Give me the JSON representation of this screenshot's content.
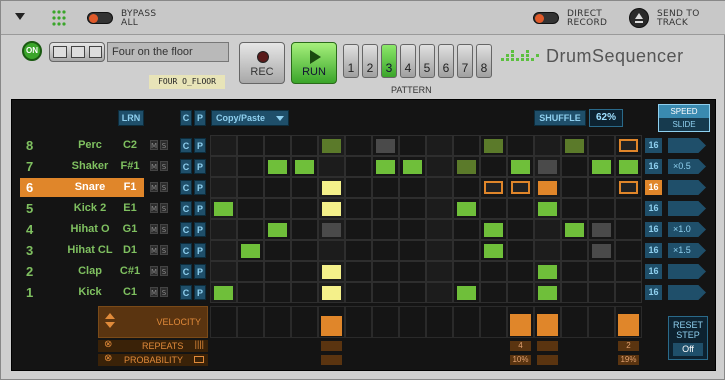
{
  "topbar": {
    "bypass_label_1": "BYPASS",
    "bypass_label_2": "ALL",
    "direct_label_1": "DIRECT",
    "direct_label_2": "RECORD",
    "send_label_1": "SEND TO",
    "send_label_2": "TRACK"
  },
  "header": {
    "on_label": "ON",
    "patch_name": "Four on the floor",
    "patch_tag": "FOUR O_FLOOR",
    "rec_label": "REC",
    "run_label": "RUN",
    "pattern_label": "PATTERN",
    "pattern_buttons": [
      "1",
      "2",
      "3",
      "4",
      "5",
      "6",
      "7",
      "8"
    ],
    "active_pattern": "3",
    "brand_name": "DrumSequencer"
  },
  "toolbar": {
    "lrn_label": "LRN",
    "c_label": "C",
    "p_label": "P",
    "copy_paste_label": "Copy/Paste",
    "shuffle_label": "SHUFFLE",
    "shuffle_value": "62%",
    "speed_label": "SPEED",
    "slide_label": "SLIDE"
  },
  "rows": [
    {
      "num": "8",
      "name": "Perc",
      "note": "C2",
      "steps_count": "16",
      "rate": ""
    },
    {
      "num": "7",
      "name": "Shaker",
      "note": "F#1",
      "steps_count": "16",
      "rate": "×0.5"
    },
    {
      "num": "6",
      "name": "Snare",
      "note": "F1",
      "steps_count": "16",
      "rate": ""
    },
    {
      "num": "5",
      "name": "Kick 2",
      "note": "E1",
      "steps_count": "16",
      "rate": ""
    },
    {
      "num": "4",
      "name": "Hihat O",
      "note": "G1",
      "steps_count": "16",
      "rate": "×1.0"
    },
    {
      "num": "3",
      "name": "Hihat CL",
      "note": "D1",
      "steps_count": "16",
      "rate": "×1.5"
    },
    {
      "num": "2",
      "name": "Clap",
      "note": "C#1",
      "steps_count": "16",
      "rate": ""
    },
    {
      "num": "1",
      "name": "Kick",
      "note": "C1",
      "steps_count": "16",
      "rate": ""
    }
  ],
  "selected_row": "6",
  "bottom": {
    "velocity_label": "VELOCITY",
    "repeats_label": "REPEATS",
    "probability_label": "PROBABILITY",
    "reset_label_1": "RESET",
    "reset_label_2": "STEP",
    "reset_value": "Off",
    "repeat_value_a": "4",
    "repeat_value_b": "2",
    "prob_value_a": "10%",
    "prob_value_b": "19%"
  },
  "colors": {
    "green": "#6fbf3a",
    "olive": "#5b7a2a",
    "yellow": "#f4f08a",
    "orange": "#e0862a",
    "grey": "#4a4a4a",
    "accent_blue": "#2a6a8a"
  }
}
